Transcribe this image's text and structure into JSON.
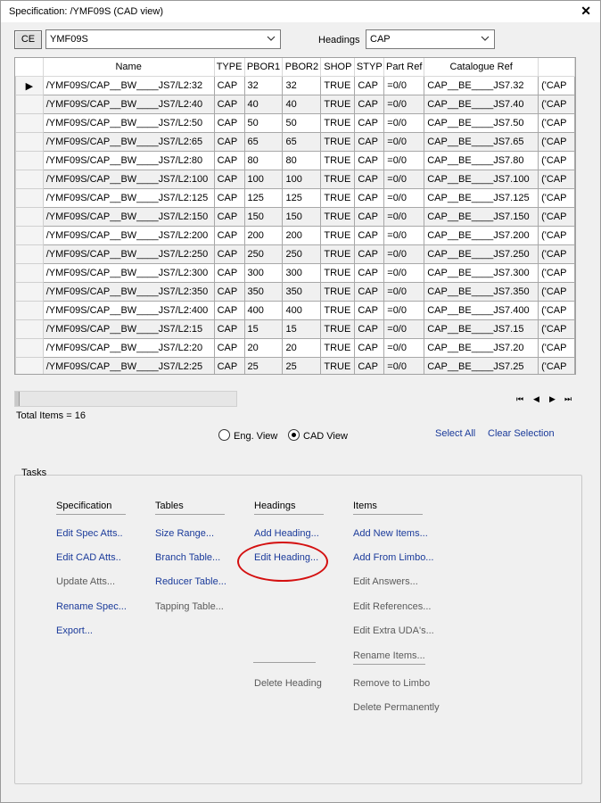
{
  "window": {
    "title": "Specification: /YMF09S (CAD view)",
    "close_glyph": "✕"
  },
  "toolbar": {
    "ce_label": "CE",
    "spec_value": "YMF09S",
    "headings_label": "Headings",
    "headings_value": "CAP"
  },
  "grid": {
    "columns": [
      "Name",
      "TYPE",
      "PBOR1",
      "PBOR2",
      "SHOP",
      "STYP",
      "Part Ref",
      "Catalogue Ref",
      ""
    ],
    "current_row_marker": "▶",
    "rows": [
      [
        "/YMF09S/CAP__BW____JS7/L2:32",
        "CAP",
        "32",
        "32",
        "TRUE",
        "CAP",
        "=0/0",
        "CAP__BE____JS7.32",
        "('CAP"
      ],
      [
        "/YMF09S/CAP__BW____JS7/L2:40",
        "CAP",
        "40",
        "40",
        "TRUE",
        "CAP",
        "=0/0",
        "CAP__BE____JS7.40",
        "('CAP"
      ],
      [
        "/YMF09S/CAP__BW____JS7/L2:50",
        "CAP",
        "50",
        "50",
        "TRUE",
        "CAP",
        "=0/0",
        "CAP__BE____JS7.50",
        "('CAP"
      ],
      [
        "/YMF09S/CAP__BW____JS7/L2:65",
        "CAP",
        "65",
        "65",
        "TRUE",
        "CAP",
        "=0/0",
        "CAP__BE____JS7.65",
        "('CAP"
      ],
      [
        "/YMF09S/CAP__BW____JS7/L2:80",
        "CAP",
        "80",
        "80",
        "TRUE",
        "CAP",
        "=0/0",
        "CAP__BE____JS7.80",
        "('CAP"
      ],
      [
        "/YMF09S/CAP__BW____JS7/L2:100",
        "CAP",
        "100",
        "100",
        "TRUE",
        "CAP",
        "=0/0",
        "CAP__BE____JS7.100",
        "('CAP"
      ],
      [
        "/YMF09S/CAP__BW____JS7/L2:125",
        "CAP",
        "125",
        "125",
        "TRUE",
        "CAP",
        "=0/0",
        "CAP__BE____JS7.125",
        "('CAP"
      ],
      [
        "/YMF09S/CAP__BW____JS7/L2:150",
        "CAP",
        "150",
        "150",
        "TRUE",
        "CAP",
        "=0/0",
        "CAP__BE____JS7.150",
        "('CAP"
      ],
      [
        "/YMF09S/CAP__BW____JS7/L2:200",
        "CAP",
        "200",
        "200",
        "TRUE",
        "CAP",
        "=0/0",
        "CAP__BE____JS7.200",
        "('CAP"
      ],
      [
        "/YMF09S/CAP__BW____JS7/L2:250",
        "CAP",
        "250",
        "250",
        "TRUE",
        "CAP",
        "=0/0",
        "CAP__BE____JS7.250",
        "('CAP"
      ],
      [
        "/YMF09S/CAP__BW____JS7/L2:300",
        "CAP",
        "300",
        "300",
        "TRUE",
        "CAP",
        "=0/0",
        "CAP__BE____JS7.300",
        "('CAP"
      ],
      [
        "/YMF09S/CAP__BW____JS7/L2:350",
        "CAP",
        "350",
        "350",
        "TRUE",
        "CAP",
        "=0/0",
        "CAP__BE____JS7.350",
        "('CAP"
      ],
      [
        "/YMF09S/CAP__BW____JS7/L2:400",
        "CAP",
        "400",
        "400",
        "TRUE",
        "CAP",
        "=0/0",
        "CAP__BE____JS7.400",
        "('CAP"
      ],
      [
        "/YMF09S/CAP__BW____JS7/L2:15",
        "CAP",
        "15",
        "15",
        "TRUE",
        "CAP",
        "=0/0",
        "CAP__BE____JS7.15",
        "('CAP"
      ],
      [
        "/YMF09S/CAP__BW____JS7/L2:20",
        "CAP",
        "20",
        "20",
        "TRUE",
        "CAP",
        "=0/0",
        "CAP__BE____JS7.20",
        "('CAP"
      ],
      [
        "/YMF09S/CAP__BW____JS7/L2:25",
        "CAP",
        "25",
        "25",
        "TRUE",
        "CAP",
        "=0/0",
        "CAP__BE____JS7.25",
        "('CAP"
      ]
    ]
  },
  "nav": {
    "first": "⏮",
    "prev": "◀",
    "next": "▶",
    "last": "⏭"
  },
  "status": {
    "total_items": "Total Items = 16"
  },
  "view": {
    "eng_label": "Eng. View",
    "cad_label": "CAD View",
    "selected": "CAD View"
  },
  "selection": {
    "select_all": "Select All",
    "clear_selection": "Clear Selection"
  },
  "tasks": {
    "label": "Tasks",
    "specification": {
      "heading": "Specification",
      "items": [
        {
          "label": "Edit Spec Atts..",
          "enabled": true
        },
        {
          "label": "Edit CAD Atts..",
          "enabled": true
        },
        {
          "label": "Update Atts...",
          "enabled": false
        },
        {
          "label": "Rename Spec...",
          "enabled": true
        },
        {
          "label": "Export...",
          "enabled": true
        }
      ]
    },
    "tables": {
      "heading": "Tables",
      "items": [
        {
          "label": "Size Range...",
          "enabled": true
        },
        {
          "label": "Branch Table...",
          "enabled": true
        },
        {
          "label": "Reducer Table...",
          "enabled": true
        },
        {
          "label": "Tapping Table...",
          "enabled": false
        }
      ]
    },
    "headings": {
      "heading": "Headings",
      "items": [
        {
          "label": "Add Heading...",
          "enabled": true
        },
        {
          "label": "Edit Heading...",
          "enabled": true,
          "highlighted": true
        },
        {
          "label": "Delete Heading",
          "enabled": false
        }
      ]
    },
    "items": {
      "heading": "Items",
      "items": [
        {
          "label": "Add New Items...",
          "enabled": true
        },
        {
          "label": "Add From Limbo...",
          "enabled": true
        },
        {
          "label": "Edit Answers...",
          "enabled": false
        },
        {
          "label": "Edit References...",
          "enabled": false
        },
        {
          "label": "Edit Extra UDA's...",
          "enabled": false
        },
        {
          "label": "Rename Items...",
          "enabled": false
        },
        {
          "label": "Remove to Limbo",
          "enabled": false
        },
        {
          "label": "Delete Permanently",
          "enabled": false
        }
      ]
    }
  },
  "colors": {
    "link": "#1a3a9a",
    "disabled": "#5a5a5a",
    "highlight_oval": "#d41010"
  }
}
